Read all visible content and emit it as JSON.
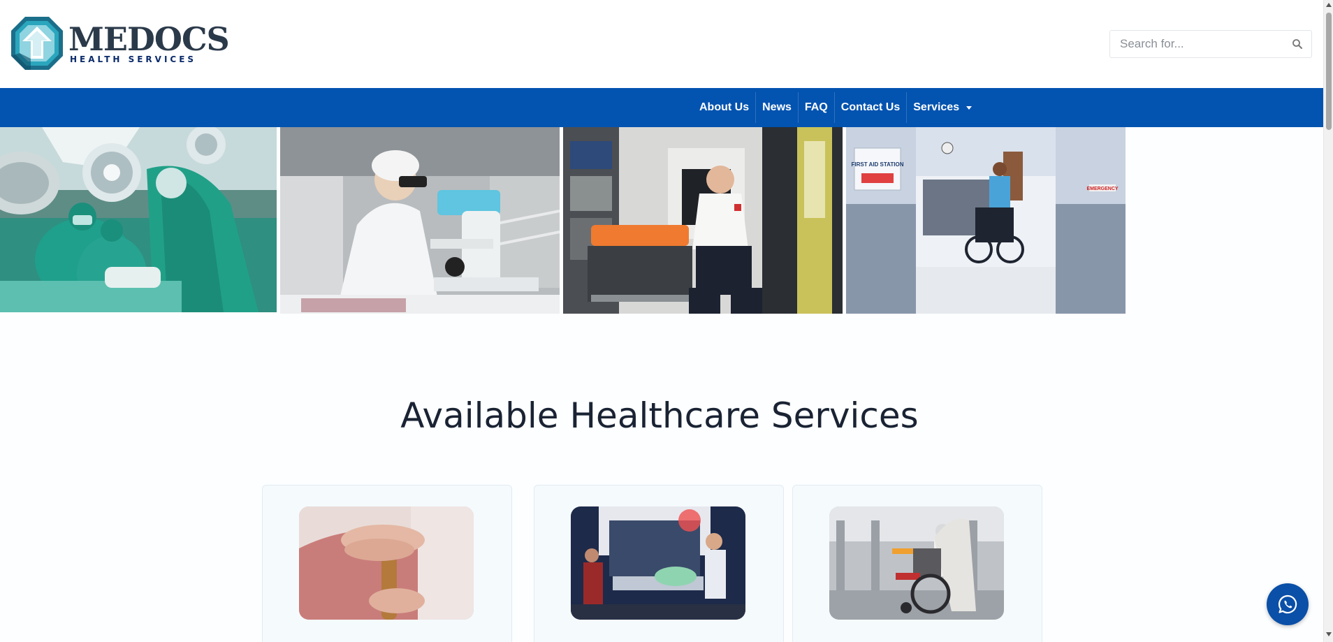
{
  "brand": {
    "name": "MEDOCS",
    "subtitle": "HEALTH SERVICES",
    "colors": {
      "primary": "#0353b0",
      "teal": "#17a2b8",
      "dark": "#2b3a4a"
    }
  },
  "search": {
    "placeholder": "Search for...",
    "value": "",
    "icon": "search-icon"
  },
  "nav": {
    "items": [
      {
        "label": "About Us"
      },
      {
        "label": "News"
      },
      {
        "label": "FAQ"
      },
      {
        "label": "Contact Us"
      },
      {
        "label": "Services",
        "has_dropdown": true
      }
    ]
  },
  "hero": {
    "images": [
      {
        "name": "surgery-team-photo"
      },
      {
        "name": "lab-microscope-photo"
      },
      {
        "name": "paramedic-ambulance-photo"
      },
      {
        "name": "first-aid-station-photo",
        "sign": "FIRST AID STATION",
        "door_sign": "EMERGENCY"
      }
    ]
  },
  "main": {
    "title": "Available Healthcare Services",
    "cards": [
      {
        "image": "elderly-hands-cane-photo"
      },
      {
        "image": "ambulance-patient-photo"
      },
      {
        "image": "airport-wheelchair-photo"
      }
    ]
  },
  "floating": {
    "whatsapp_icon": "whatsapp-icon"
  }
}
